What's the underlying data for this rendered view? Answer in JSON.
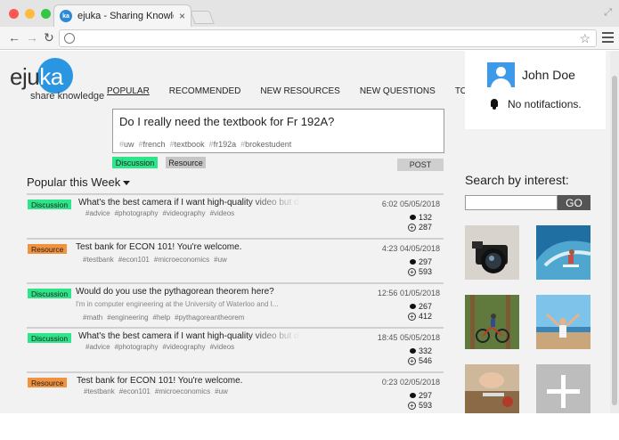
{
  "browser": {
    "tab_title": "ejuka - Sharing Knowledge",
    "favicon_text": "ka",
    "tab_close": "×",
    "url": "",
    "traffic_lights": [
      "#fc5753",
      "#fdbc40",
      "#33c748"
    ]
  },
  "logo": {
    "brand_a": "eju",
    "brand_b": "ka",
    "tagline": "share knowledge",
    "accent": "#2a95e0"
  },
  "nav": {
    "items": [
      {
        "label": "POPULAR",
        "active": true
      },
      {
        "label": "RECOMMENDED"
      },
      {
        "label": "NEW RESOURCES"
      },
      {
        "label": "NEW QUESTIONS"
      },
      {
        "label": "TOPICS"
      }
    ]
  },
  "composer": {
    "question": "Do I really need the textbook for Fr 192A?",
    "tags": [
      "uw",
      "french",
      "textbook",
      "fr192a",
      "brokestudent"
    ],
    "type_discussion": "Discussion",
    "type_resource": "Resource",
    "post_label": "POST"
  },
  "feed": {
    "heading": "Popular this Week",
    "posts": [
      {
        "type": "Discussion",
        "title": "What's the best camera if I want high-quality video but d",
        "snippet": "",
        "tags": [
          "advice",
          "photography",
          "videography",
          "videos"
        ],
        "time": "6:02",
        "date": "05/05/2018",
        "comments": "132",
        "votes": "287"
      },
      {
        "type": "Resource",
        "title": "Test bank for ECON 101! You're welcome.",
        "snippet": "",
        "tags": [
          "testbank",
          "econ101",
          "microeconomics",
          "uw"
        ],
        "time": "4:23",
        "date": "04/05/2018",
        "comments": "297",
        "votes": "593"
      },
      {
        "type": "Discussion",
        "title": "Would do you use the pythagorean theorem here?",
        "snippet": "I'm in computer engineering at the University of Waterloo and I...",
        "tags": [
          "math",
          "engineering",
          "help",
          "pythagoreantheorem"
        ],
        "time": "12:56",
        "date": "01/05/2018",
        "comments": "267",
        "votes": "412"
      },
      {
        "type": "Discussion",
        "title": "What's the best camera if I want high-quality video but d",
        "snippet": "",
        "tags": [
          "advice",
          "photography",
          "videography",
          "videos"
        ],
        "time": "18:45",
        "date": "05/05/2018",
        "comments": "332",
        "votes": "546"
      },
      {
        "type": "Resource",
        "title": "Test bank for ECON 101! You're welcome.",
        "snippet": "",
        "tags": [
          "testbank",
          "econ101",
          "microeconomics",
          "uw"
        ],
        "time": "0:23",
        "date": "02/05/2018",
        "comments": "297",
        "votes": "593"
      }
    ]
  },
  "profile": {
    "name": "John Doe",
    "notifications": "No notifactions."
  },
  "interests": {
    "heading": "Search by interest:",
    "go_label": "GO",
    "tiles": [
      "camera",
      "surfing",
      "mountain-biking",
      "beach",
      "cooking",
      "add"
    ]
  },
  "colors": {
    "discussion": "#2ee68a",
    "resource": "#f0923e"
  }
}
